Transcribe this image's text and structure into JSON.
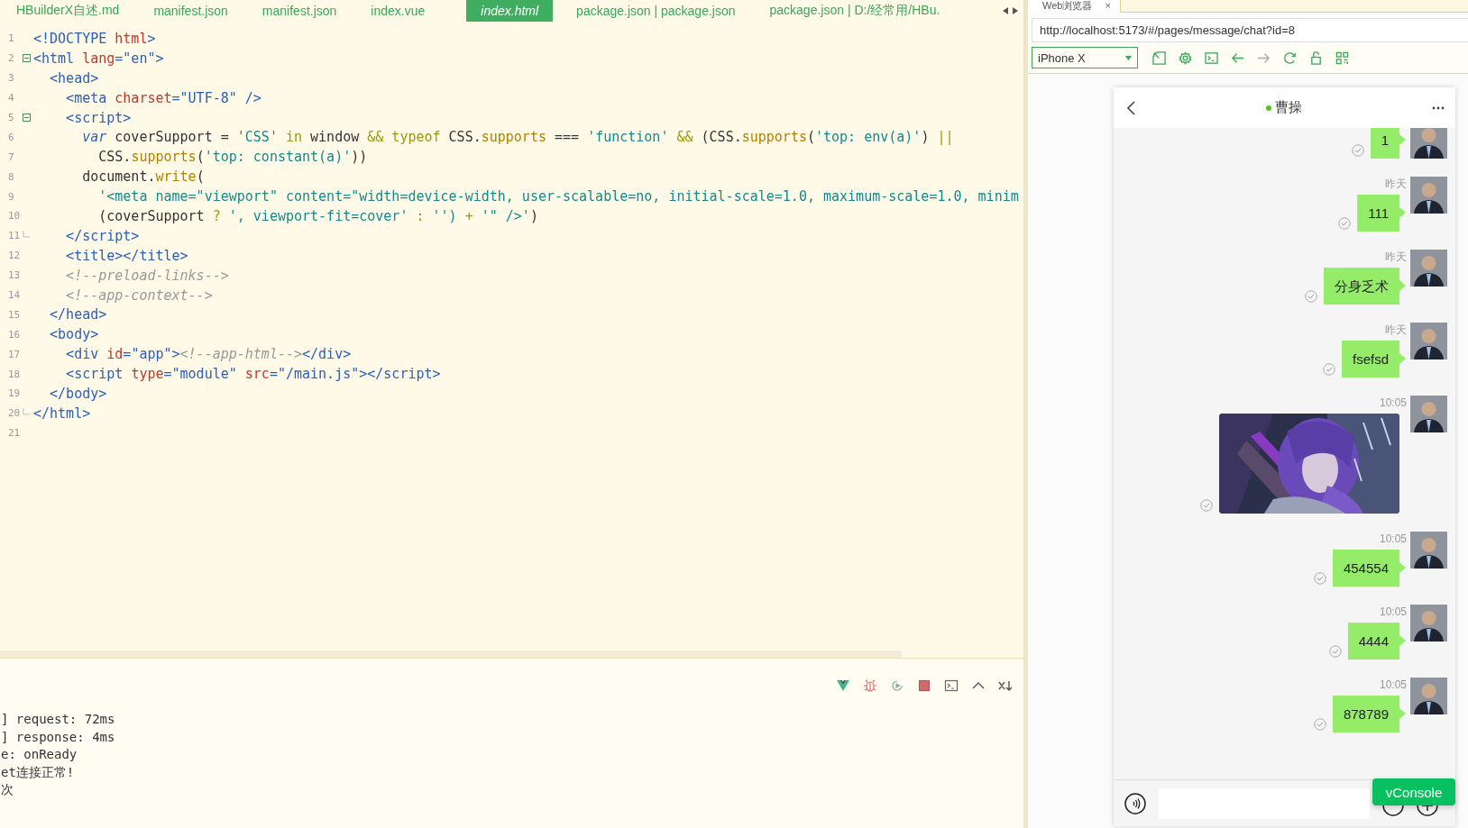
{
  "editor_tabs": [
    {
      "label": "HBuilderX自述.md",
      "selected": false
    },
    {
      "label": "manifest.json",
      "selected": false
    },
    {
      "label": "manifest.json",
      "selected": false
    },
    {
      "label": "index.vue",
      "selected": false
    },
    {
      "label": "index.html",
      "selected": true
    },
    {
      "label": "package.json | package.json",
      "selected": false
    },
    {
      "label": "package.json | D:/经常用/HBu.",
      "selected": false
    }
  ],
  "code_lines": [
    {
      "number": "1",
      "tokens": [
        {
          "text": "<!DOCTYPE ",
          "kind": "tag"
        },
        {
          "text": "html",
          "kind": "attr"
        },
        {
          "text": ">",
          "kind": "tag"
        }
      ]
    },
    {
      "number": "2",
      "foldable": true,
      "tokens": [
        {
          "text": "<html ",
          "kind": "tag"
        },
        {
          "text": "lang",
          "kind": "attr"
        },
        {
          "text": "=",
          "kind": "tag"
        },
        {
          "text": "\"en\"",
          "kind": "val"
        },
        {
          "text": ">",
          "kind": "tag"
        }
      ]
    },
    {
      "number": "3",
      "tokens": [
        {
          "text": "  <head>",
          "kind": "tag"
        }
      ]
    },
    {
      "number": "4",
      "tokens": [
        {
          "text": "    <meta ",
          "kind": "tag"
        },
        {
          "text": "charset",
          "kind": "attr"
        },
        {
          "text": "=",
          "kind": "tag"
        },
        {
          "text": "\"UTF-8\"",
          "kind": "val"
        },
        {
          "text": " />",
          "kind": "tag"
        }
      ]
    },
    {
      "number": "5",
      "foldable": true,
      "tokens": [
        {
          "text": "    <script>",
          "kind": "tag"
        }
      ]
    },
    {
      "number": "6",
      "tokens": [
        {
          "text": "      var",
          "kind": "kw"
        },
        {
          "text": " coverSupport = ",
          "kind": "text"
        },
        {
          "text": "'CSS'",
          "kind": "str"
        },
        {
          "text": " in ",
          "kind": "op"
        },
        {
          "text": "window ",
          "kind": "text"
        },
        {
          "text": "&& typeof",
          "kind": "op"
        },
        {
          "text": " CSS.",
          "kind": "text"
        },
        {
          "text": "supports",
          "kind": "fn"
        },
        {
          "text": " === ",
          "kind": "text"
        },
        {
          "text": "'function'",
          "kind": "str"
        },
        {
          "text": " && ",
          "kind": "op"
        },
        {
          "text": "(CSS.",
          "kind": "text"
        },
        {
          "text": "supports",
          "kind": "fn"
        },
        {
          "text": "(",
          "kind": "text"
        },
        {
          "text": "'top: env(a)'",
          "kind": "str"
        },
        {
          "text": ") ",
          "kind": "text"
        },
        {
          "text": "||",
          "kind": "op"
        }
      ]
    },
    {
      "number": "7",
      "tokens": [
        {
          "text": "        CSS.",
          "kind": "text"
        },
        {
          "text": "supports",
          "kind": "fn"
        },
        {
          "text": "(",
          "kind": "text"
        },
        {
          "text": "'top: constant(a)'",
          "kind": "str"
        },
        {
          "text": "))",
          "kind": "text"
        }
      ]
    },
    {
      "number": "8",
      "tokens": [
        {
          "text": "      document.",
          "kind": "text"
        },
        {
          "text": "write",
          "kind": "fn"
        },
        {
          "text": "(",
          "kind": "text"
        }
      ]
    },
    {
      "number": "9",
      "tokens": [
        {
          "text": "        '<meta name=\"viewport\" content=\"width=device-width, user-scalable=no, initial-scale=1.0, maximum-scale=1.0, minim",
          "kind": "str"
        }
      ]
    },
    {
      "number": "10",
      "tokens": [
        {
          "text": "        (coverSupport ",
          "kind": "text"
        },
        {
          "text": "?",
          "kind": "op"
        },
        {
          "text": " ', viewport-fit=cover' ",
          "kind": "str"
        },
        {
          "text": ":",
          "kind": "op"
        },
        {
          "text": " '') ",
          "kind": "str"
        },
        {
          "text": "+",
          "kind": "op"
        },
        {
          "text": " '\" />'",
          "kind": "str"
        },
        {
          "text": ")",
          "kind": "text"
        }
      ]
    },
    {
      "number": "11",
      "fold_end": true,
      "tokens": [
        {
          "text": "    </script>",
          "kind": "tag"
        }
      ]
    },
    {
      "number": "12",
      "tokens": [
        {
          "text": "    <title></title>",
          "kind": "tag"
        }
      ]
    },
    {
      "number": "13",
      "tokens": [
        {
          "text": "    <!--preload-links-->",
          "kind": "comment"
        }
      ]
    },
    {
      "number": "14",
      "tokens": [
        {
          "text": "    <!--app-context-->",
          "kind": "comment"
        }
      ]
    },
    {
      "number": "15",
      "tokens": [
        {
          "text": "  </head>",
          "kind": "tag"
        }
      ]
    },
    {
      "number": "16",
      "tokens": [
        {
          "text": "  <body>",
          "kind": "tag"
        }
      ]
    },
    {
      "number": "17",
      "tokens": [
        {
          "text": "    <div ",
          "kind": "tag"
        },
        {
          "text": "id",
          "kind": "attr"
        },
        {
          "text": "=",
          "kind": "tag"
        },
        {
          "text": "\"app\"",
          "kind": "val"
        },
        {
          "text": ">",
          "kind": "tag"
        },
        {
          "text": "<!--app-html-->",
          "kind": "comment"
        },
        {
          "text": "</div>",
          "kind": "tag"
        }
      ]
    },
    {
      "number": "18",
      "tokens": [
        {
          "text": "    <script ",
          "kind": "tag"
        },
        {
          "text": "type",
          "kind": "attr"
        },
        {
          "text": "=",
          "kind": "tag"
        },
        {
          "text": "\"module\"",
          "kind": "val"
        },
        {
          "text": " src",
          "kind": "attr"
        },
        {
          "text": "=",
          "kind": "tag"
        },
        {
          "text": "\"/main.js\"",
          "kind": "val"
        },
        {
          "text": "></script>",
          "kind": "tag"
        }
      ]
    },
    {
      "number": "19",
      "tokens": [
        {
          "text": "  </body>",
          "kind": "tag"
        }
      ]
    },
    {
      "number": "20",
      "fold_end": true,
      "tokens": [
        {
          "text": "</html>",
          "kind": "tag"
        }
      ]
    },
    {
      "number": "21"
    }
  ],
  "console": {
    "tools": [
      {
        "kind": "vue"
      },
      {
        "kind": "bug"
      },
      {
        "kind": "replay"
      },
      {
        "kind": "stop"
      },
      {
        "kind": "terminal"
      },
      {
        "kind": "collapse"
      },
      {
        "kind": "clear"
      }
    ],
    "lines": [
      "] request: 72ms",
      "] response: 4ms",
      "e: onReady",
      "et连接正常!",
      "次"
    ]
  },
  "browser": {
    "tab_title": "Web浏览器",
    "tab_close": "×",
    "url": "http://localhost:5173/#/pages/message/chat?id=8",
    "device": "iPhone X",
    "tools": [
      {
        "kind": "resize",
        "disabled": false
      },
      {
        "kind": "settings",
        "disabled": false
      },
      {
        "kind": "terminal",
        "disabled": false
      },
      {
        "kind": "back",
        "disabled": false
      },
      {
        "kind": "forward",
        "disabled": true
      },
      {
        "kind": "reload",
        "disabled": false
      },
      {
        "kind": "lock",
        "disabled": false
      },
      {
        "kind": "qrcode",
        "disabled": false
      }
    ]
  },
  "chat": {
    "title": "曹操",
    "online": true,
    "messages": [
      {
        "kind": "text",
        "text": "1",
        "read": true
      },
      {
        "kind": "text",
        "time": "昨天",
        "text": "111",
        "read": true
      },
      {
        "kind": "text",
        "time": "昨天",
        "text": "分身乏术",
        "read": true
      },
      {
        "kind": "text",
        "time": "昨天",
        "text": "fsefsd",
        "read": true
      },
      {
        "kind": "picture",
        "time": "10:05",
        "read": true
      },
      {
        "kind": "text",
        "time": "10:05",
        "text": "454554",
        "read": true
      },
      {
        "kind": "text",
        "time": "10:05",
        "text": "4444",
        "read": true
      },
      {
        "kind": "text",
        "time": "10:05",
        "text": "878789",
        "read": true
      }
    ]
  },
  "vconsole_button": "vConsole"
}
